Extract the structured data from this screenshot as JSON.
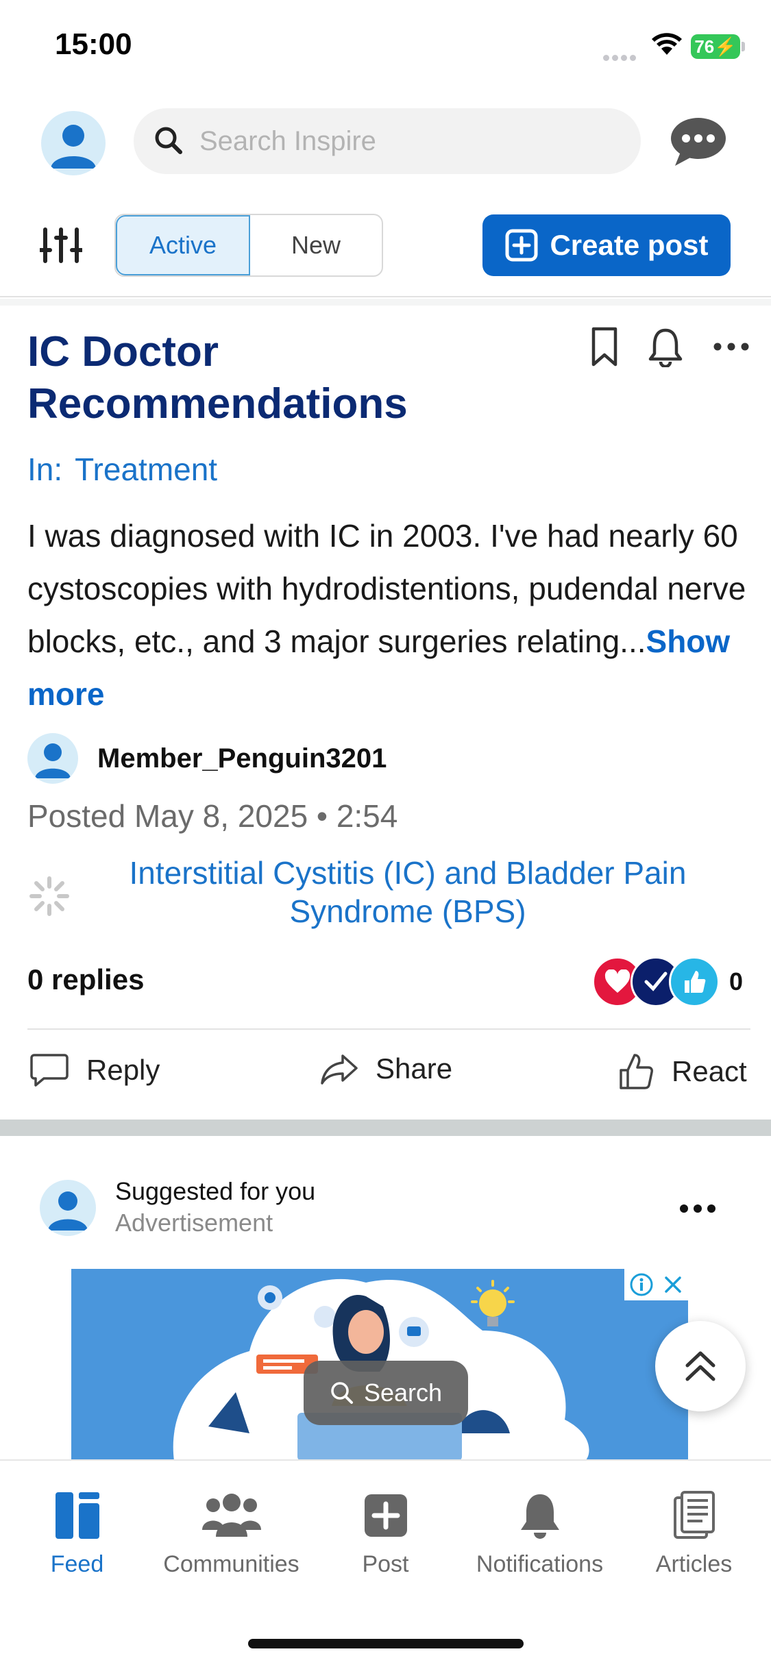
{
  "status": {
    "time": "15:00",
    "battery": "76"
  },
  "header": {
    "search_placeholder": "Search Inspire"
  },
  "toolbar": {
    "tab_active": "Active",
    "tab_new": "New",
    "create_post": "Create post"
  },
  "post": {
    "title": "IC Doctor Recommendations",
    "in_label": "In:",
    "category": "Treatment",
    "body": "I was diagnosed with IC in 2003. I've had nearly 60 cystoscopies with hydrodistentions, pudendal nerve blocks, etc., and 3 major surgeries relating...",
    "show_more": "Show more",
    "author": "Member_Penguin3201",
    "posted": "Posted May 8, 2025 • 2:54",
    "community": "Interstitial Cystitis (IC) and Bladder Pain Syndrome (BPS)",
    "replies": "0 replies",
    "reaction_count": "0",
    "actions": {
      "reply": "Reply",
      "share": "Share",
      "react": "React"
    }
  },
  "suggested": {
    "title": "Suggested for you",
    "subtitle": "Advertisement"
  },
  "floating": {
    "search": "Search"
  },
  "tabs": [
    {
      "label": "Feed",
      "icon": "feed-icon"
    },
    {
      "label": "Communities",
      "icon": "communities-icon"
    },
    {
      "label": "Post",
      "icon": "post-icon"
    },
    {
      "label": "Notifications",
      "icon": "bell-icon"
    },
    {
      "label": "Articles",
      "icon": "articles-icon"
    }
  ],
  "colors": {
    "brand": "#0a66c8",
    "title": "#0b2a73",
    "link": "#1a73c9",
    "battery": "#34c759"
  }
}
